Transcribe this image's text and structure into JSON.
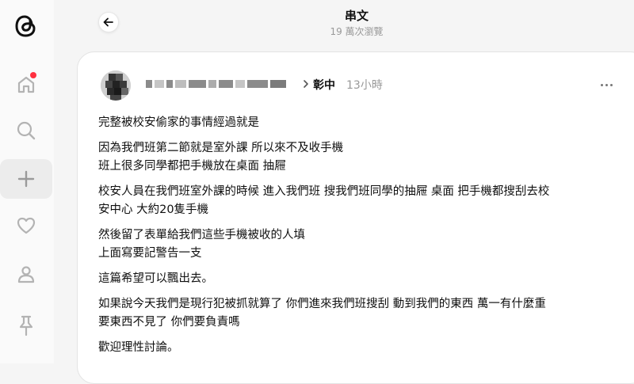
{
  "header": {
    "title": "串文",
    "views": "19 萬次瀏覽"
  },
  "sidebar": {
    "items": [
      {
        "icon": "threads-logo-icon"
      },
      {
        "icon": "home-icon",
        "has_notification": true
      },
      {
        "icon": "search-icon"
      },
      {
        "icon": "plus-icon",
        "active": true
      },
      {
        "icon": "heart-icon"
      },
      {
        "icon": "profile-icon"
      },
      {
        "icon": "pin-icon"
      }
    ]
  },
  "post": {
    "username_redacted": true,
    "location": "彰中",
    "time": "13小時",
    "paragraphs": [
      [
        "完整被校安偷家的事情經過就是"
      ],
      [
        "因為我們班第二節就是室外課 所以來不及收手機",
        "班上很多同學都把手機放在桌面 抽屜"
      ],
      [
        "校安人員在我們班室外課的時候 進入我們班 搜我們班同學的抽屜 桌面 把手機都搜刮去校",
        "安中心 大約20隻手機"
      ],
      [
        "然後留了表單給我們這些手機被收的人填",
        "上面寫要記警告一支"
      ],
      [
        "這篇希望可以飄出去。"
      ],
      [
        "如果說今天我們是現行犯被抓就算了 你們進來我們班搜刮 動到我們的東西 萬一有什麼重",
        "要東西不見了 你們要負責嗎"
      ],
      [
        "歡迎理性討論。"
      ]
    ]
  },
  "colors": {
    "notification": "#ff3040",
    "text": "#101010",
    "muted": "#999999"
  }
}
